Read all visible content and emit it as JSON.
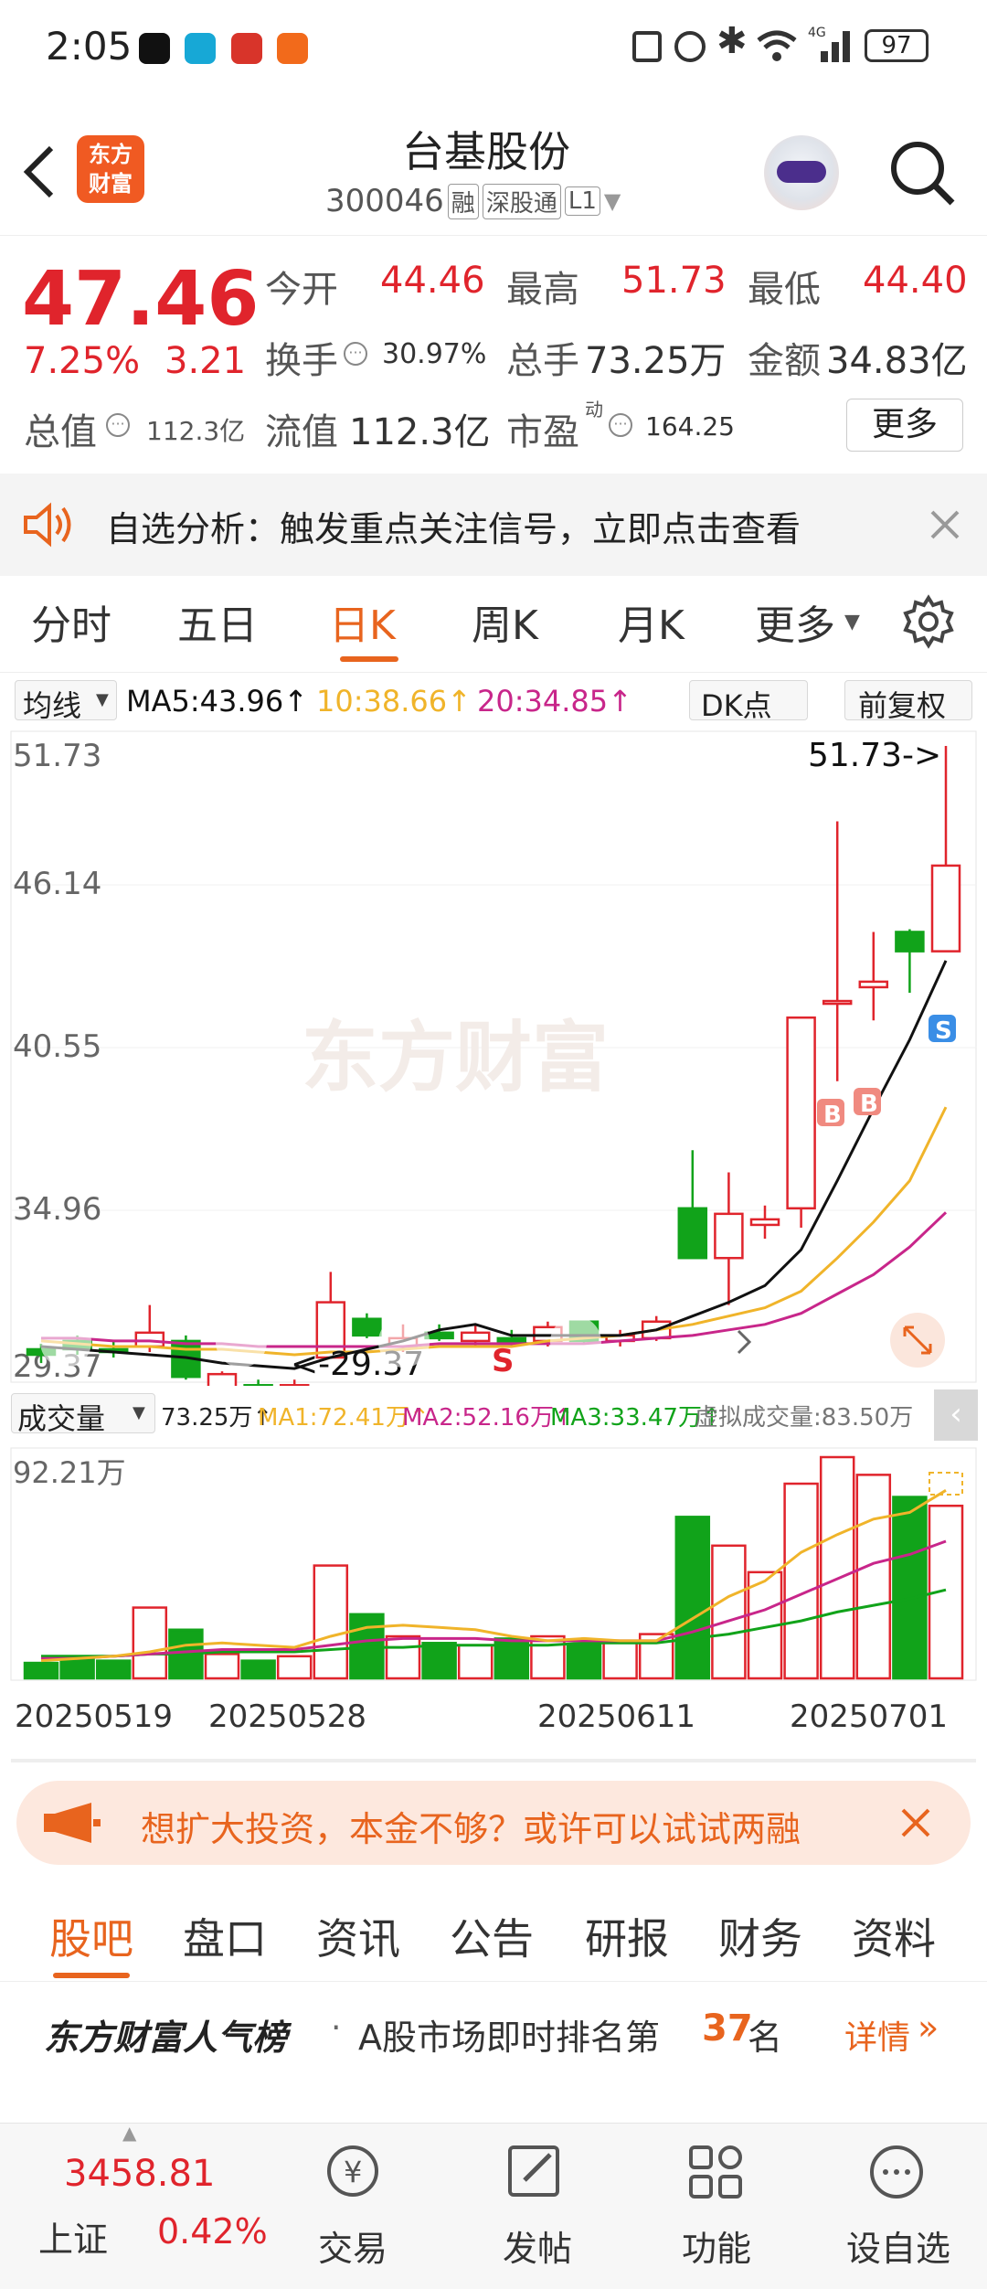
{
  "status_bar": {
    "time": "2:05",
    "battery": "97"
  },
  "header": {
    "title": "台基股份",
    "code": "300046",
    "tags": [
      "融",
      "深股通",
      "L1"
    ],
    "logo_text": [
      "东方",
      "财富"
    ]
  },
  "quote": {
    "price": "47.46",
    "change_pct": "7.25%",
    "change": "3.21",
    "open_label": "今开",
    "open": "44.46",
    "high_label": "最高",
    "high": "51.73",
    "low_label": "最低",
    "low": "44.40",
    "turnover_label": "换手",
    "turnover": "30.97%",
    "volume_label": "总手",
    "volume": "73.25万",
    "amount_label": "金额",
    "amount": "34.83亿",
    "mktcap_label": "总值",
    "mktcap": "112.3亿",
    "float_label": "流值",
    "float_cap": "112.3亿",
    "pe_label": "市盈",
    "pe_sup": "动",
    "pe": "164.25",
    "more_label": "更多"
  },
  "banner": {
    "text": "自选分析：触发重点关注信号，立即点击查看"
  },
  "chart_tabs": [
    "分时",
    "五日",
    "日K",
    "周K",
    "月K",
    "更多"
  ],
  "active_tab": "日K",
  "indicator_bar": {
    "selector": "均线",
    "ma5": "MA5:43.96↑",
    "ma10": "10:38.66↑",
    "ma20": "20:34.85↑",
    "dk": "DK点",
    "adjust": "前复权"
  },
  "kchart": {
    "y_labels": [
      "51.73",
      "46.14",
      "40.55",
      "34.96",
      "29.37"
    ],
    "max_label": "51.73->",
    "min_label": "<-29.37",
    "watermark": "东方财富",
    "signals": [
      "B",
      "B",
      "S",
      "S"
    ]
  },
  "volume_bar": {
    "selector": "成交量",
    "vol": "73.25万↑",
    "ma1": "MA1:72.41万↑",
    "ma2": "MA2:52.16万↑",
    "ma3": "MA3:33.47万↑",
    "virtual": "虚拟成交量:83.50万",
    "max_label": "92.21万"
  },
  "x_dates": [
    "20250519",
    "20250528",
    "20250611",
    "20250701"
  ],
  "colors": {
    "up": "#e0242c",
    "down": "#11a31a",
    "ma5": "#111111",
    "ma10": "#f0b42a",
    "ma20": "#c8268a",
    "accent": "#e8641e"
  },
  "chart_data": {
    "type": "candlestick",
    "ylim": [
      29.37,
      51.73
    ],
    "candles": [
      {
        "o": 29.9,
        "c": 29.7,
        "h": 30.1,
        "l": 29.4
      },
      {
        "o": 30.2,
        "c": 29.9,
        "h": 30.4,
        "l": 29.7
      },
      {
        "o": 29.9,
        "c": 29.8,
        "h": 30.2,
        "l": 29.6
      },
      {
        "o": 30.0,
        "c": 30.5,
        "h": 31.5,
        "l": 29.8
      },
      {
        "o": 30.2,
        "c": 28.9,
        "h": 30.4,
        "l": 28.8
      },
      {
        "o": 28.5,
        "c": 29.0,
        "h": 29.1,
        "l": 28.3
      },
      {
        "o": 28.6,
        "c": 28.5,
        "h": 28.8,
        "l": 28.4
      },
      {
        "o": 28.5,
        "c": 28.6,
        "h": 28.8,
        "l": 28.3
      },
      {
        "o": 29.6,
        "c": 31.6,
        "h": 32.7,
        "l": 29.6
      },
      {
        "o": 31.0,
        "c": 30.4,
        "h": 31.2,
        "l": 30.3
      },
      {
        "o": 30.0,
        "c": 30.3,
        "h": 30.8,
        "l": 29.8
      },
      {
        "o": 30.5,
        "c": 30.3,
        "h": 30.8,
        "l": 30.2
      },
      {
        "o": 30.2,
        "c": 30.5,
        "h": 30.8,
        "l": 30.0
      },
      {
        "o": 30.3,
        "c": 30.1,
        "h": 30.6,
        "l": 30.0
      },
      {
        "o": 30.2,
        "c": 30.7,
        "h": 30.9,
        "l": 30.0
      },
      {
        "o": 30.9,
        "c": 30.2,
        "h": 30.9,
        "l": 30.1
      },
      {
        "o": 30.2,
        "c": 30.4,
        "h": 30.6,
        "l": 30.0
      },
      {
        "o": 30.3,
        "c": 30.9,
        "h": 31.1,
        "l": 30.2
      },
      {
        "o": 35.0,
        "c": 33.2,
        "h": 37.1,
        "l": 33.2
      },
      {
        "o": 33.2,
        "c": 34.8,
        "h": 36.3,
        "l": 31.5
      },
      {
        "o": 34.4,
        "c": 34.6,
        "h": 35.1,
        "l": 33.9
      },
      {
        "o": 35.0,
        "c": 41.9,
        "h": 41.9,
        "l": 34.3
      },
      {
        "o": 42.5,
        "c": 42.5,
        "h": 49.0,
        "l": 39.6
      },
      {
        "o": 43.0,
        "c": 43.2,
        "h": 45.0,
        "l": 41.8
      },
      {
        "o": 45.0,
        "c": 44.3,
        "h": 45.1,
        "l": 42.8
      },
      {
        "o": 44.3,
        "c": 47.4,
        "h": 51.73,
        "l": 44.3
      }
    ],
    "ma5": [
      30.0,
      29.9,
      29.8,
      29.7,
      29.6,
      29.4,
      29.3,
      29.2,
      29.6,
      29.9,
      30.2,
      30.6,
      30.8,
      30.4,
      30.4,
      30.4,
      30.4,
      30.6,
      31.1,
      31.6,
      32.2,
      33.5,
      36.0,
      38.6,
      41.1,
      43.96
    ],
    "ma10": [
      30.2,
      30.1,
      30.0,
      30.0,
      29.9,
      29.9,
      29.8,
      29.7,
      29.8,
      29.8,
      29.9,
      30.0,
      30.0,
      30.0,
      30.2,
      30.3,
      30.4,
      30.6,
      30.8,
      31.1,
      31.4,
      32.0,
      33.2,
      34.5,
      36.0,
      38.66
    ],
    "ma20": [
      30.3,
      30.3,
      30.2,
      30.2,
      30.1,
      30.1,
      30.0,
      30.0,
      30.0,
      30.0,
      30.0,
      30.1,
      30.1,
      30.1,
      30.1,
      30.1,
      30.2,
      30.3,
      30.4,
      30.6,
      30.8,
      31.2,
      31.9,
      32.6,
      33.6,
      34.85
    ],
    "volumes": [
      7,
      10,
      8,
      32,
      22,
      11,
      8,
      10,
      51,
      29,
      19,
      16,
      15,
      18,
      19,
      15,
      16,
      20,
      73,
      60,
      48,
      88,
      100,
      92,
      82,
      78
    ],
    "vol_ma1": [
      8,
      9,
      10,
      12,
      15,
      16,
      15,
      14,
      19,
      23,
      24,
      23,
      22,
      19,
      17,
      18,
      17,
      17,
      27,
      37,
      44,
      57,
      65,
      72,
      75,
      85
    ],
    "vol_ma2": [
      9,
      9,
      10,
      11,
      12,
      13,
      13,
      13,
      15,
      17,
      18,
      18,
      18,
      17,
      17,
      17,
      17,
      17,
      21,
      26,
      31,
      38,
      45,
      52,
      56,
      62
    ],
    "vol_ma3": [
      10,
      10,
      10,
      11,
      11,
      12,
      12,
      12,
      13,
      14,
      14,
      15,
      15,
      15,
      15,
      16,
      16,
      16,
      18,
      20,
      23,
      26,
      30,
      33,
      36,
      40
    ],
    "vol_max": 92.21
  },
  "promo": {
    "text": "想扩大投资，本金不够？或许可以试试两融"
  },
  "sub_tabs": [
    "股吧",
    "盘口",
    "资讯",
    "公告",
    "研报",
    "财务",
    "资料"
  ],
  "active_sub_tab": "股吧",
  "rank": {
    "title": "东方财富人气榜",
    "text_pre": "A股市场即时排名第",
    "rank": "37",
    "text_post": "名",
    "more": "详情"
  },
  "bottom": {
    "index_value": "3458.81",
    "index_name": "上证",
    "index_change": "0.42%",
    "trade": "交易",
    "post": "发帖",
    "func": "功能",
    "watch": "设自选"
  }
}
